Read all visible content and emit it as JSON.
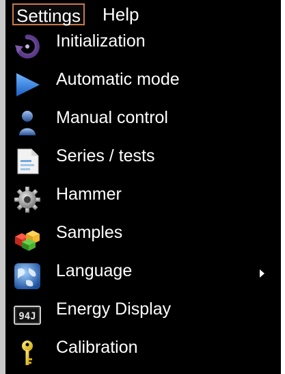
{
  "menubar": {
    "items": [
      {
        "label": "Settings"
      },
      {
        "label": "Help"
      }
    ]
  },
  "menu": {
    "items": [
      {
        "label": "Initialization",
        "icon": "refresh-icon"
      },
      {
        "label": "Automatic mode",
        "icon": "play-icon"
      },
      {
        "label": "Manual control",
        "icon": "user-icon"
      },
      {
        "label": "Series / tests",
        "icon": "document-icon"
      },
      {
        "label": "Hammer",
        "icon": "gear-icon"
      },
      {
        "label": "Samples",
        "icon": "cubes-icon"
      },
      {
        "label": "Language",
        "icon": "globe-icon",
        "has_submenu": true
      },
      {
        "label": "Energy Display",
        "icon": "energy-display-icon",
        "icon_text": "94J"
      },
      {
        "label": "Calibration",
        "icon": "key-icon"
      }
    ]
  },
  "colors": {
    "menu_background": "#000000",
    "text": "#ffffff",
    "active_border": "#c87a4a"
  }
}
